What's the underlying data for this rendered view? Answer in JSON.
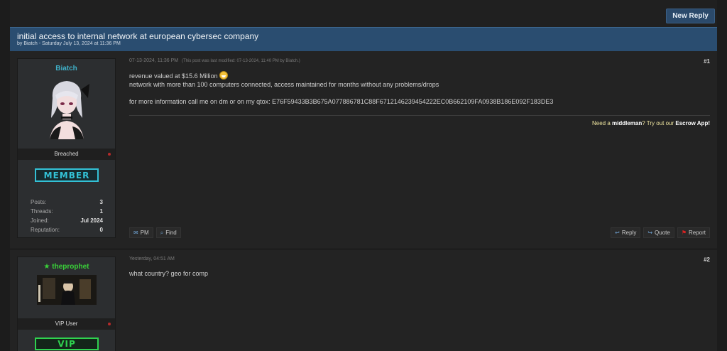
{
  "toolbar": {
    "new_reply_label": "New Reply"
  },
  "thread": {
    "title": "initial access to internal network at european cybersec company",
    "subtitle": "by Biatch - Saturday July 13, 2024 at 11:36 PM"
  },
  "posts": [
    {
      "author": "Biatch",
      "rank": "Breached",
      "badge": "MEMBER",
      "stats": [
        {
          "label": "Posts:",
          "value": "3"
        },
        {
          "label": "Threads:",
          "value": "1"
        },
        {
          "label": "Joined:",
          "value": "Jul 2024"
        },
        {
          "label": "Reputation:",
          "value": "0"
        }
      ],
      "timestamp": "07-13-2024, 11:36 PM",
      "edit_note": "(This post was last modified: 07-13-2024, 11:40 PM by Biatch.)",
      "number": "#1",
      "lines": [
        "revenue valued at $15.6 Million",
        "network with more than 100 computers connected, access maintained for months without any problems/drops",
        "for more information call me on dm or on my qtox: E76F59433B3B675A077886781C88F6712146239454222EC0B662109FA0938B186E092F183DE3"
      ],
      "signature": {
        "prefix": "Need a ",
        "bold1": "middleman",
        "mid": "? Try out our ",
        "bold2": "Escrow App!"
      },
      "actions_left": [
        {
          "icon": "mail-icon",
          "label": "PM"
        },
        {
          "icon": "search-icon",
          "label": "Find"
        }
      ],
      "actions_right": [
        {
          "icon": "reply-icon",
          "label": "Reply"
        },
        {
          "icon": "quote-icon",
          "label": "Quote"
        },
        {
          "icon": "flag-icon",
          "label": "Report"
        }
      ]
    },
    {
      "author": "theprophet",
      "rank": "VIP User",
      "badge": "VIP",
      "timestamp": "Yesterday, 04:51 AM",
      "number": "#2",
      "lines": [
        "what country? geo for comp"
      ]
    }
  ],
  "colors": {
    "header_bg": "#2a4d70",
    "member_badge": "#33c1d6",
    "vip_badge": "#2fd24f",
    "author1": "#3fb0c8",
    "author2": "#39d039"
  }
}
